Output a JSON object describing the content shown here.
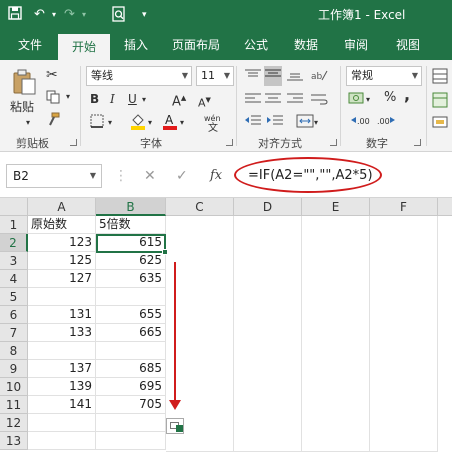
{
  "window": {
    "title": "工作簿1 - Excel"
  },
  "ribbon_tabs": [
    "文件",
    "开始",
    "插入",
    "页面布局",
    "公式",
    "数据",
    "审阅",
    "视图"
  ],
  "clipboard": {
    "paste_label": "粘贴",
    "group_label": "剪贴板"
  },
  "font": {
    "name": "等线",
    "size": "11",
    "group_label": "字体",
    "wen_label": "wén"
  },
  "alignment": {
    "group_label": "对齐方式"
  },
  "number": {
    "format": "常规",
    "group_label": "数字",
    "percent": "%",
    "comma": ","
  },
  "formula_bar": {
    "name_box": "B2",
    "cancel_symbol": "✕",
    "enter_symbol": "✓",
    "fx_symbol": "fx",
    "formula": "=IF(A2=\"\",\"\",A2*5)"
  },
  "columns": [
    "A",
    "B",
    "C",
    "D",
    "E",
    "F"
  ],
  "rows": [
    {
      "num": "1",
      "a": "原始数",
      "b": "5倍数"
    },
    {
      "num": "2",
      "a": "123",
      "b": "615"
    },
    {
      "num": "3",
      "a": "125",
      "b": "625"
    },
    {
      "num": "4",
      "a": "127",
      "b": "635"
    },
    {
      "num": "5",
      "a": "",
      "b": ""
    },
    {
      "num": "6",
      "a": "131",
      "b": "655"
    },
    {
      "num": "7",
      "a": "133",
      "b": "665"
    },
    {
      "num": "8",
      "a": "",
      "b": ""
    },
    {
      "num": "9",
      "a": "137",
      "b": "685"
    },
    {
      "num": "10",
      "a": "139",
      "b": "695"
    },
    {
      "num": "11",
      "a": "141",
      "b": "705"
    },
    {
      "num": "12",
      "a": "",
      "b": ""
    },
    {
      "num": "13",
      "a": "",
      "b": ""
    }
  ],
  "colors": {
    "accent": "#217346",
    "annotation": "#d01c1c"
  }
}
